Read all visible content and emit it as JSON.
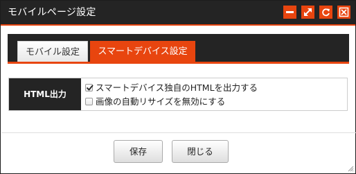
{
  "window": {
    "title": "モバイルページ設定",
    "accent_color": "#e8450f",
    "titlebar_color": "#242424",
    "controls": [
      "minimize-icon",
      "maximize-icon",
      "refresh-icon",
      "close-icon"
    ]
  },
  "tabs": [
    {
      "label": "モバイル設定",
      "active": false
    },
    {
      "label": "スマートデバイス設定",
      "active": true
    }
  ],
  "settings": {
    "row_label": "HTML出力",
    "options": [
      {
        "label": "スマートデバイス独自のHTMLを出力する",
        "checked": true
      },
      {
        "label": "画像の自動リサイズを無効にする",
        "checked": false
      }
    ]
  },
  "footer": {
    "save_label": "保存",
    "close_label": "閉じる"
  }
}
